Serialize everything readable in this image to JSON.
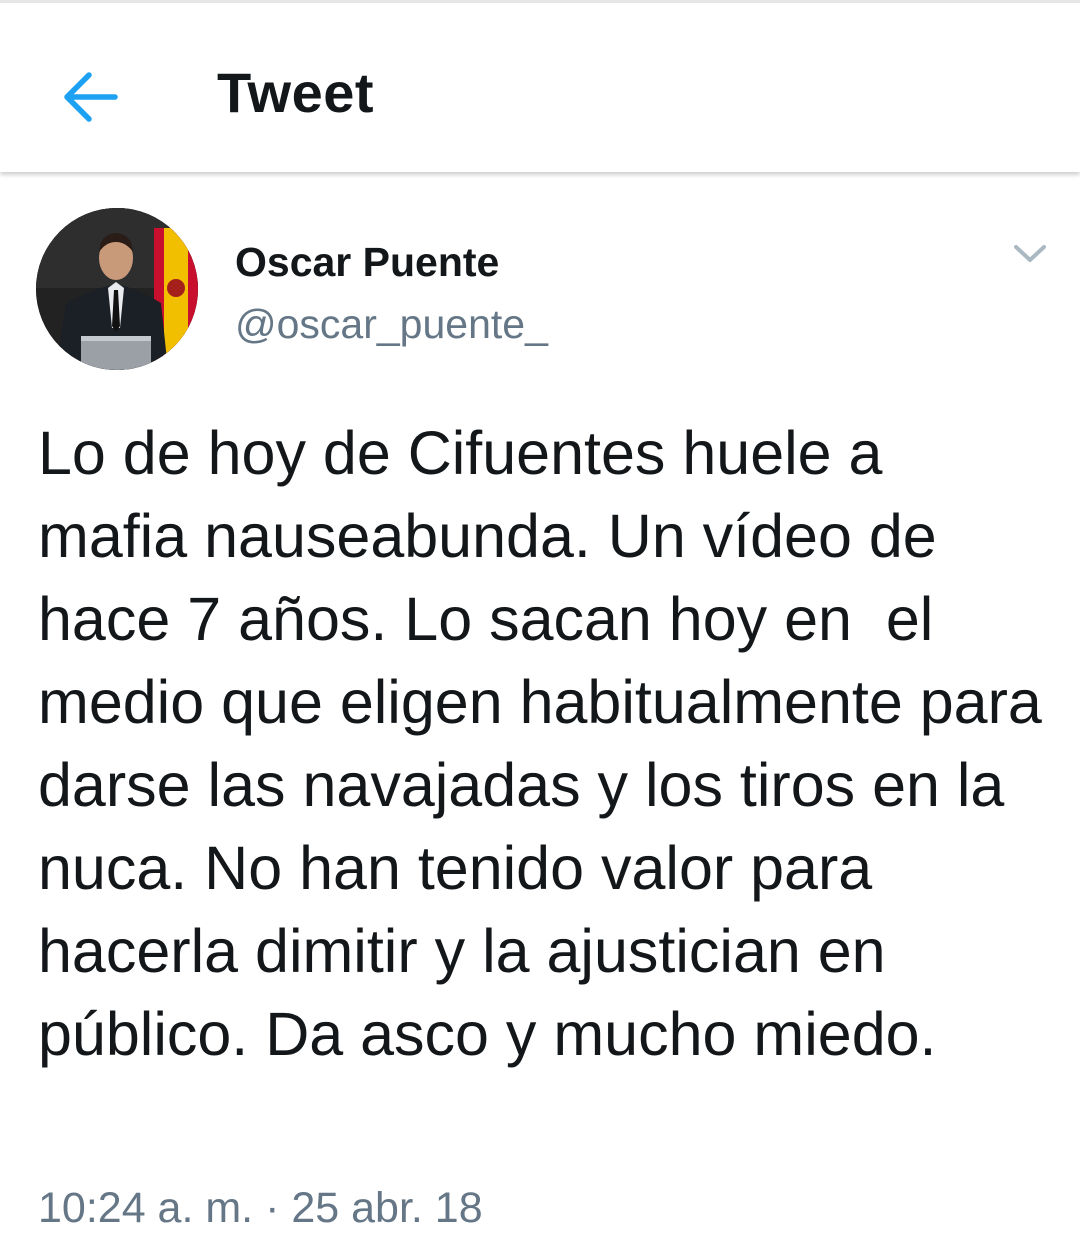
{
  "header": {
    "title": "Tweet",
    "back_icon": "arrow-left-icon",
    "accent_color": "#1da1f2"
  },
  "tweet": {
    "author_name": "Oscar Puente",
    "author_handle": "@oscar_puente_",
    "menu_icon": "chevron-down-icon",
    "text": "Lo de hoy de Cifuentes huele a mafia nauseabunda. Un vídeo de hace 7 años. Lo sacan hoy en  el medio que eligen habitualmente para darse las navajadas y los tiros en la nuca. No han tenido valor para hacerla dimitir y la ajustician en público. Da asco y mucho miedo.",
    "timestamp": "10:24 a. m. · 25 abr. 18"
  }
}
